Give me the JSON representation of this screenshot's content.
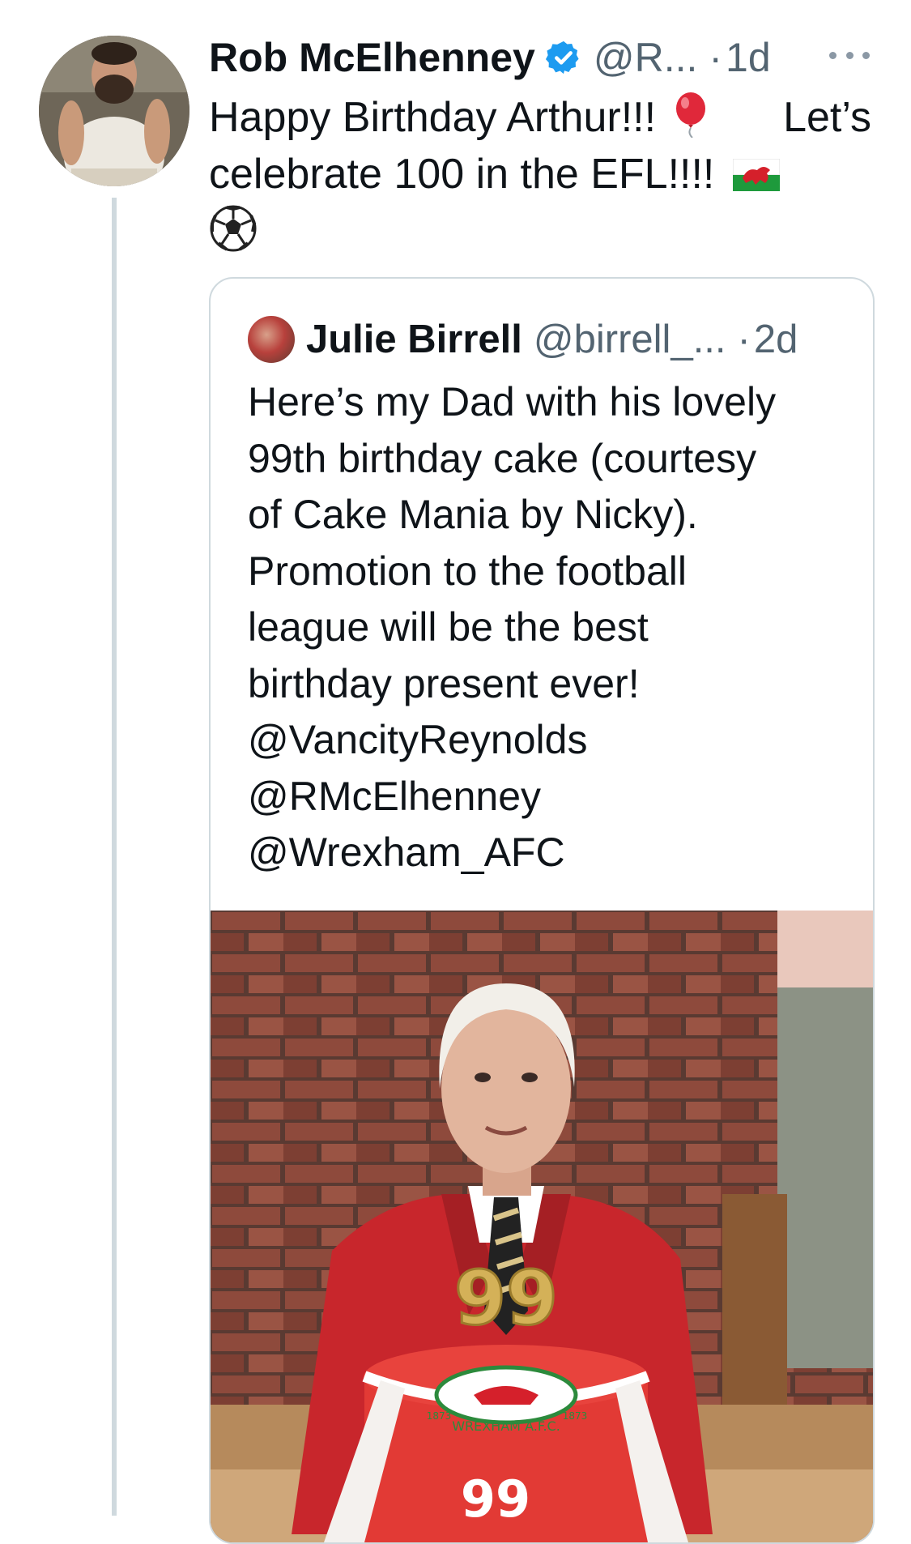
{
  "tweet": {
    "author_name": "Rob McElhenney",
    "author_handle": "@R...",
    "time": "1d",
    "text_line1": "Happy Birthday Arthur!!!",
    "text_line1b": "Let’s",
    "text_line2": "celebrate 100 in the EFL!!!!",
    "emojis": [
      "balloon-icon",
      "wales-flag-icon",
      "soccer-ball-icon"
    ]
  },
  "quote": {
    "author_name": "Julie Birrell",
    "author_handle": "@birrell_...",
    "time": "2d",
    "lines": [
      "Here’s my Dad with his lovely",
      "99th birthday cake (courtesy",
      "of Cake Mania by Nicky).",
      "Promotion to the football",
      "league will be the best",
      "birthday present ever!",
      "@VancityReynolds",
      "@RMcElhenney",
      "@Wrexham_AFC"
    ],
    "photo": {
      "candle_numbers": "99",
      "cake_number": "99",
      "crest_text": "WREXHAM A.F.C.",
      "crest_year_left": "1873",
      "crest_year_right": "1873"
    }
  },
  "colors": {
    "verified": "#1d9bf0",
    "secondary_text": "#536471",
    "border": "#cfd9de",
    "cardigan": "#c8262c",
    "cake": "#e23a35"
  }
}
